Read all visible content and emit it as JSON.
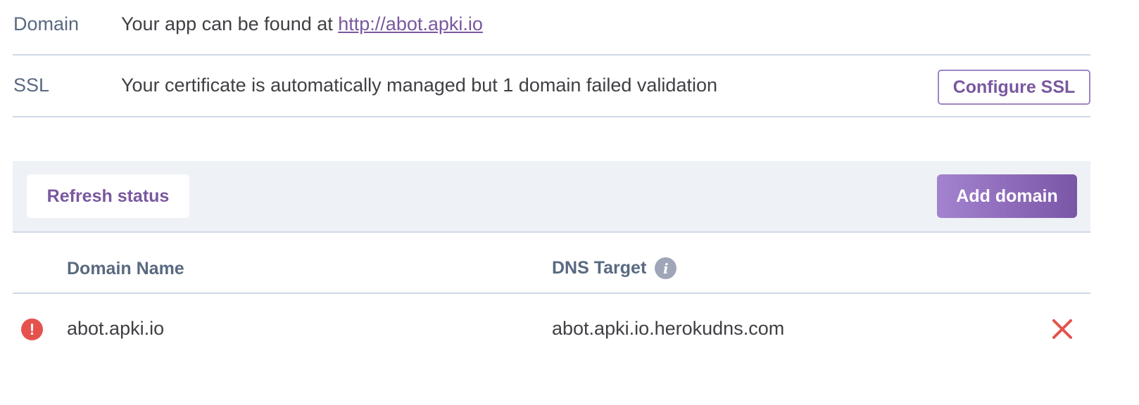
{
  "domain_row": {
    "label": "Domain",
    "text": "Your app can be found at ",
    "link": "http://abot.apki.io"
  },
  "ssl_row": {
    "label": "SSL",
    "text": "Your certificate is automatically managed but 1 domain failed validation",
    "button": "Configure SSL"
  },
  "toolbar": {
    "refresh_label": "Refresh status",
    "add_label": "Add domain"
  },
  "table": {
    "headers": {
      "name": "Domain Name",
      "dns": "DNS Target",
      "info_icon": "info-icon"
    },
    "rows": [
      {
        "status_icon": "alert-icon",
        "name": "abot.apki.io",
        "dns": "abot.apki.io.herokudns.com",
        "remove_icon": "close-icon"
      }
    ]
  },
  "colors": {
    "accent": "#79589f",
    "error": "#e5524d",
    "label": "#596981",
    "toolbar_bg": "#eef1f6"
  }
}
